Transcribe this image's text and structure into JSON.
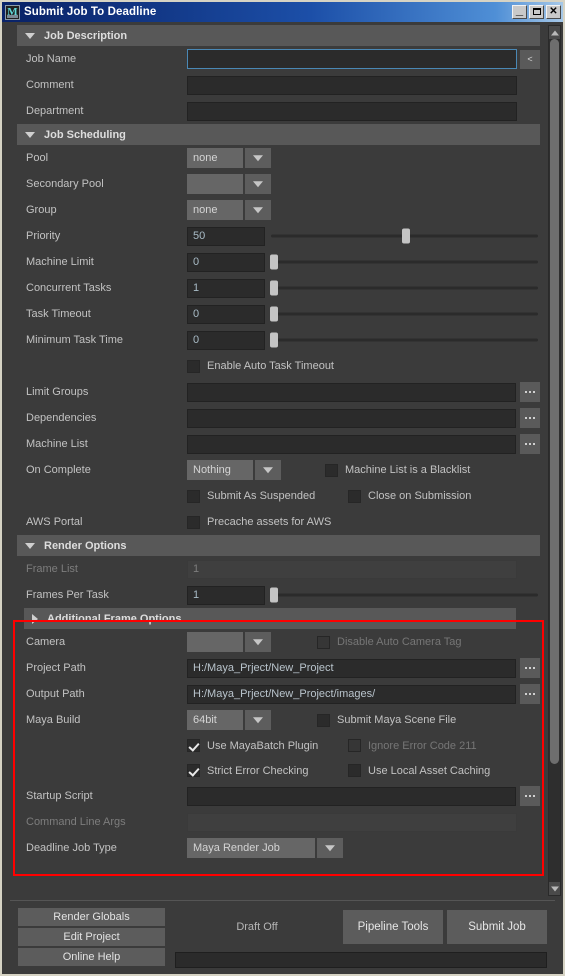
{
  "window": {
    "title": "Submit Job To Deadline",
    "app_icon": "maya-m-icon",
    "minimize": "_",
    "maximize": "maximize-icon",
    "close": "✕"
  },
  "sections": {
    "job_description": "Job Description",
    "job_scheduling": "Job Scheduling",
    "render_options": "Render Options",
    "additional_frame_options": "Additional Frame Options"
  },
  "job_description": {
    "job_name_label": "Job Name",
    "job_name_value": "",
    "job_name_button": "<",
    "comment_label": "Comment",
    "comment_value": "",
    "department_label": "Department",
    "department_value": ""
  },
  "job_scheduling": {
    "pool_label": "Pool",
    "pool_value": "none",
    "secondary_pool_label": "Secondary Pool",
    "secondary_pool_value": "",
    "group_label": "Group",
    "group_value": "none",
    "priority_label": "Priority",
    "priority_value": "50",
    "priority_pct": 50,
    "machine_limit_label": "Machine Limit",
    "machine_limit_value": "0",
    "machine_limit_pct": 1,
    "concurrent_tasks_label": "Concurrent Tasks",
    "concurrent_tasks_value": "1",
    "concurrent_tasks_pct": 1,
    "task_timeout_label": "Task Timeout",
    "task_timeout_value": "0",
    "task_timeout_pct": 1,
    "minimum_task_time_label": "Minimum Task Time",
    "minimum_task_time_value": "0",
    "minimum_task_time_pct": 1,
    "enable_auto_task_timeout": "Enable Auto Task Timeout",
    "limit_groups_label": "Limit Groups",
    "limit_groups_value": "",
    "dependencies_label": "Dependencies",
    "dependencies_value": "",
    "machine_list_label": "Machine List",
    "machine_list_value": "",
    "on_complete_label": "On Complete",
    "on_complete_value": "Nothing",
    "machine_list_blacklist": "Machine List is a Blacklist",
    "submit_as_suspended": "Submit As Suspended",
    "close_on_submission": "Close on Submission",
    "aws_portal_label": "AWS Portal",
    "precache_assets_for_aws": "Precache assets for AWS"
  },
  "render_options": {
    "frame_list_label": "Frame List",
    "frame_list_value": "1",
    "frames_per_task_label": "Frames Per Task",
    "frames_per_task_value": "1",
    "frames_per_task_pct": 1,
    "camera_label": "Camera",
    "camera_value": "",
    "disable_auto_camera_tag": "Disable Auto Camera Tag",
    "project_path_label": "Project Path",
    "project_path_value": "H:/Maya_Prject/New_Project",
    "output_path_label": "Output Path",
    "output_path_value": "H:/Maya_Prject/New_Project/images/",
    "maya_build_label": "Maya Build",
    "maya_build_value": "64bit",
    "submit_maya_scene_file": "Submit Maya Scene File",
    "use_mayabatch_plugin": "Use MayaBatch Plugin",
    "ignore_error_code_211": "Ignore Error Code 211",
    "strict_error_checking": "Strict Error Checking",
    "use_local_asset_caching": "Use Local Asset Caching",
    "startup_script_label": "Startup Script",
    "startup_script_value": "",
    "command_line_args_label": "Command Line Args",
    "command_line_args_value": "",
    "deadline_job_type_label": "Deadline Job Type",
    "deadline_job_type_value": "Maya Render Job"
  },
  "footer": {
    "render_globals": "Render Globals",
    "edit_project": "Edit Project",
    "online_help": "Online Help",
    "draft_status": "Draft Off",
    "pipeline_tools": "Pipeline Tools",
    "submit_job": "Submit Job"
  },
  "colors": {
    "title_gradient_start": "#0a246a",
    "title_gradient_end": "#a6c8e8",
    "panel_bg": "#3b3b3b",
    "section_header": "#585858",
    "field_bg": "#2b2b2b",
    "focus_border": "#4a88b5",
    "annotation_red": "#ff0000"
  }
}
